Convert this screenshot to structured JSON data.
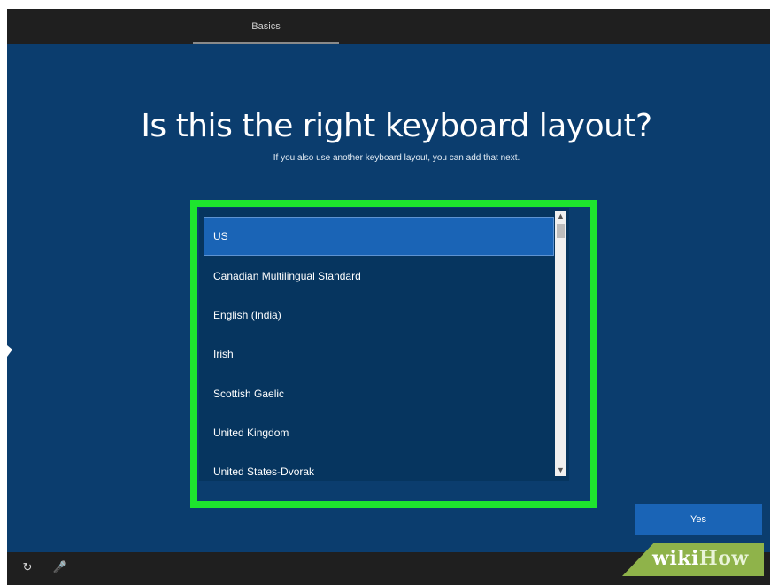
{
  "header": {
    "tab_label": "Basics"
  },
  "main": {
    "title": "Is this the right keyboard layout?",
    "subtitle": "If you also use another keyboard layout, you can add that next.",
    "layouts": [
      "US",
      "Canadian Multilingual Standard",
      "English (India)",
      "Irish",
      "Scottish Gaelic",
      "United Kingdom",
      "United States-Dvorak"
    ],
    "selected_layout": "US",
    "yes_label": "Yes"
  },
  "footer": {
    "icons": [
      "ease-of-access-icon",
      "microphone-icon"
    ]
  },
  "watermark": {
    "part1": "wiki",
    "part2": "How"
  },
  "colors": {
    "background": "#0b3d6e",
    "accent": "#1a64b6",
    "highlight_frame": "#1ee52e",
    "bar": "#1f1f1f"
  }
}
